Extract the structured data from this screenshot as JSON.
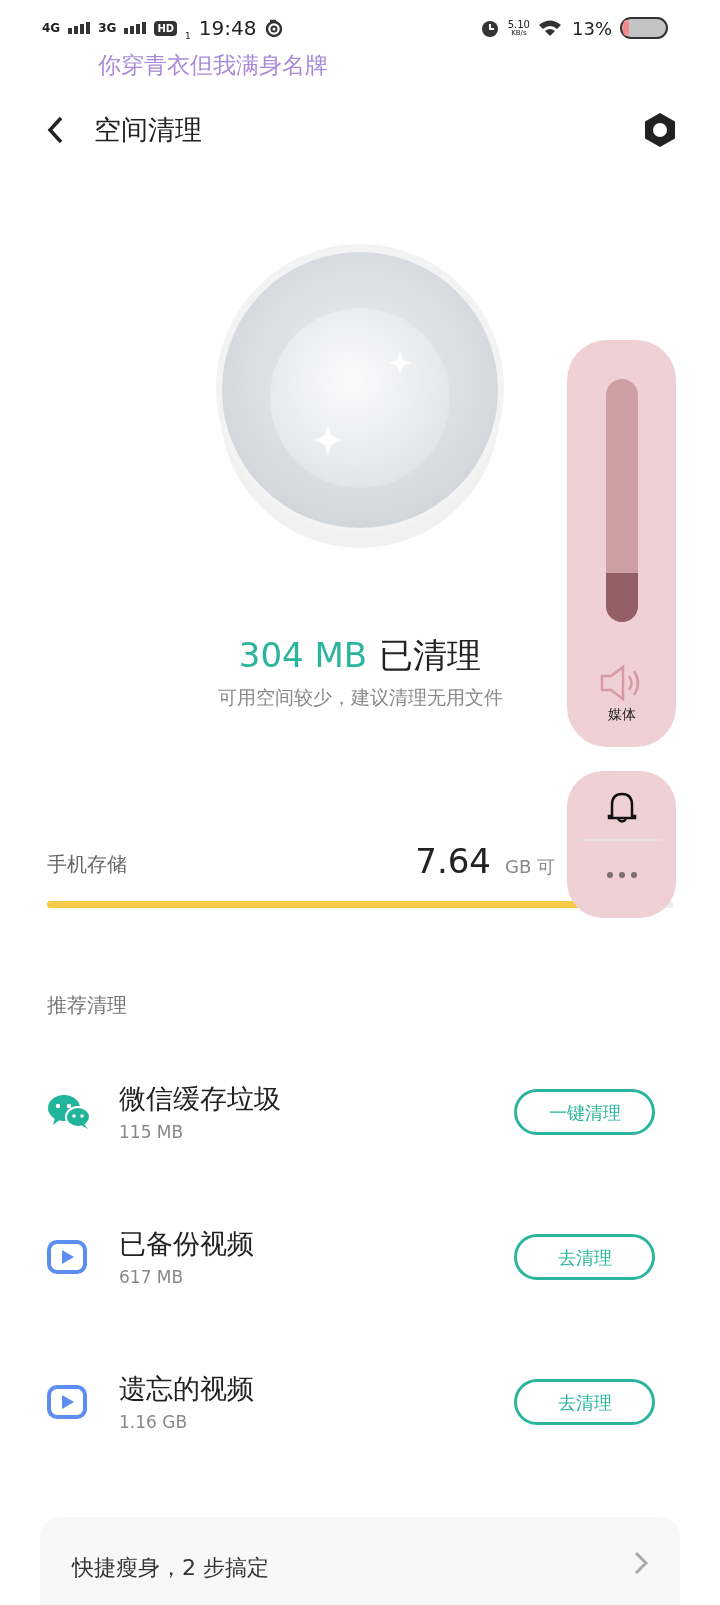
{
  "status_bar": {
    "network_1": "4G",
    "network_2": "3G",
    "hd": "HD",
    "sim": "1",
    "time": "19:48",
    "speed_value": "5.10",
    "speed_unit": "KB/s",
    "battery": "13%"
  },
  "lyric": "你穿青衣但我满身名牌",
  "header": {
    "title": "空间清理"
  },
  "result": {
    "amount": "304 MB",
    "label": "已清理",
    "hint": "可用空间较少，建议清理无用文件"
  },
  "storage": {
    "label": "手机存储",
    "value": "7.64",
    "unit": "GB 可",
    "level": 0.95
  },
  "section_title": "推荐清理",
  "items": [
    {
      "kind": "wechat",
      "title": "微信缓存垃圾",
      "size": "115 MB",
      "action": "一键清理"
    },
    {
      "kind": "video",
      "title": "已备份视频",
      "size": "617 MB",
      "action": "去清理"
    },
    {
      "kind": "video",
      "title": "遗忘的视频",
      "size": "1.16 GB",
      "action": "去清理"
    }
  ],
  "slim_card": {
    "text": "快捷瘦身，2 步搞定"
  },
  "volume_panel": {
    "level": 0.2,
    "label": "媒体"
  }
}
